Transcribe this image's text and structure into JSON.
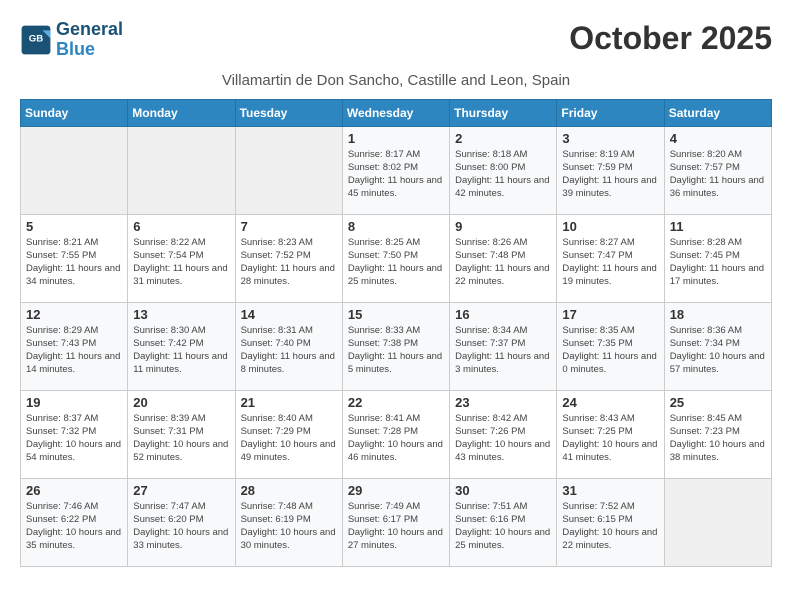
{
  "logo": {
    "line1": "General",
    "line2": "Blue"
  },
  "title": "October 2025",
  "subtitle": "Villamartin de Don Sancho, Castille and Leon, Spain",
  "days_of_week": [
    "Sunday",
    "Monday",
    "Tuesday",
    "Wednesday",
    "Thursday",
    "Friday",
    "Saturday"
  ],
  "weeks": [
    [
      {
        "day": "",
        "info": ""
      },
      {
        "day": "",
        "info": ""
      },
      {
        "day": "",
        "info": ""
      },
      {
        "day": "1",
        "info": "Sunrise: 8:17 AM\nSunset: 8:02 PM\nDaylight: 11 hours and 45 minutes."
      },
      {
        "day": "2",
        "info": "Sunrise: 8:18 AM\nSunset: 8:00 PM\nDaylight: 11 hours and 42 minutes."
      },
      {
        "day": "3",
        "info": "Sunrise: 8:19 AM\nSunset: 7:59 PM\nDaylight: 11 hours and 39 minutes."
      },
      {
        "day": "4",
        "info": "Sunrise: 8:20 AM\nSunset: 7:57 PM\nDaylight: 11 hours and 36 minutes."
      }
    ],
    [
      {
        "day": "5",
        "info": "Sunrise: 8:21 AM\nSunset: 7:55 PM\nDaylight: 11 hours and 34 minutes."
      },
      {
        "day": "6",
        "info": "Sunrise: 8:22 AM\nSunset: 7:54 PM\nDaylight: 11 hours and 31 minutes."
      },
      {
        "day": "7",
        "info": "Sunrise: 8:23 AM\nSunset: 7:52 PM\nDaylight: 11 hours and 28 minutes."
      },
      {
        "day": "8",
        "info": "Sunrise: 8:25 AM\nSunset: 7:50 PM\nDaylight: 11 hours and 25 minutes."
      },
      {
        "day": "9",
        "info": "Sunrise: 8:26 AM\nSunset: 7:48 PM\nDaylight: 11 hours and 22 minutes."
      },
      {
        "day": "10",
        "info": "Sunrise: 8:27 AM\nSunset: 7:47 PM\nDaylight: 11 hours and 19 minutes."
      },
      {
        "day": "11",
        "info": "Sunrise: 8:28 AM\nSunset: 7:45 PM\nDaylight: 11 hours and 17 minutes."
      }
    ],
    [
      {
        "day": "12",
        "info": "Sunrise: 8:29 AM\nSunset: 7:43 PM\nDaylight: 11 hours and 14 minutes."
      },
      {
        "day": "13",
        "info": "Sunrise: 8:30 AM\nSunset: 7:42 PM\nDaylight: 11 hours and 11 minutes."
      },
      {
        "day": "14",
        "info": "Sunrise: 8:31 AM\nSunset: 7:40 PM\nDaylight: 11 hours and 8 minutes."
      },
      {
        "day": "15",
        "info": "Sunrise: 8:33 AM\nSunset: 7:38 PM\nDaylight: 11 hours and 5 minutes."
      },
      {
        "day": "16",
        "info": "Sunrise: 8:34 AM\nSunset: 7:37 PM\nDaylight: 11 hours and 3 minutes."
      },
      {
        "day": "17",
        "info": "Sunrise: 8:35 AM\nSunset: 7:35 PM\nDaylight: 11 hours and 0 minutes."
      },
      {
        "day": "18",
        "info": "Sunrise: 8:36 AM\nSunset: 7:34 PM\nDaylight: 10 hours and 57 minutes."
      }
    ],
    [
      {
        "day": "19",
        "info": "Sunrise: 8:37 AM\nSunset: 7:32 PM\nDaylight: 10 hours and 54 minutes."
      },
      {
        "day": "20",
        "info": "Sunrise: 8:39 AM\nSunset: 7:31 PM\nDaylight: 10 hours and 52 minutes."
      },
      {
        "day": "21",
        "info": "Sunrise: 8:40 AM\nSunset: 7:29 PM\nDaylight: 10 hours and 49 minutes."
      },
      {
        "day": "22",
        "info": "Sunrise: 8:41 AM\nSunset: 7:28 PM\nDaylight: 10 hours and 46 minutes."
      },
      {
        "day": "23",
        "info": "Sunrise: 8:42 AM\nSunset: 7:26 PM\nDaylight: 10 hours and 43 minutes."
      },
      {
        "day": "24",
        "info": "Sunrise: 8:43 AM\nSunset: 7:25 PM\nDaylight: 10 hours and 41 minutes."
      },
      {
        "day": "25",
        "info": "Sunrise: 8:45 AM\nSunset: 7:23 PM\nDaylight: 10 hours and 38 minutes."
      }
    ],
    [
      {
        "day": "26",
        "info": "Sunrise: 7:46 AM\nSunset: 6:22 PM\nDaylight: 10 hours and 35 minutes."
      },
      {
        "day": "27",
        "info": "Sunrise: 7:47 AM\nSunset: 6:20 PM\nDaylight: 10 hours and 33 minutes."
      },
      {
        "day": "28",
        "info": "Sunrise: 7:48 AM\nSunset: 6:19 PM\nDaylight: 10 hours and 30 minutes."
      },
      {
        "day": "29",
        "info": "Sunrise: 7:49 AM\nSunset: 6:17 PM\nDaylight: 10 hours and 27 minutes."
      },
      {
        "day": "30",
        "info": "Sunrise: 7:51 AM\nSunset: 6:16 PM\nDaylight: 10 hours and 25 minutes."
      },
      {
        "day": "31",
        "info": "Sunrise: 7:52 AM\nSunset: 6:15 PM\nDaylight: 10 hours and 22 minutes."
      },
      {
        "day": "",
        "info": ""
      }
    ]
  ]
}
